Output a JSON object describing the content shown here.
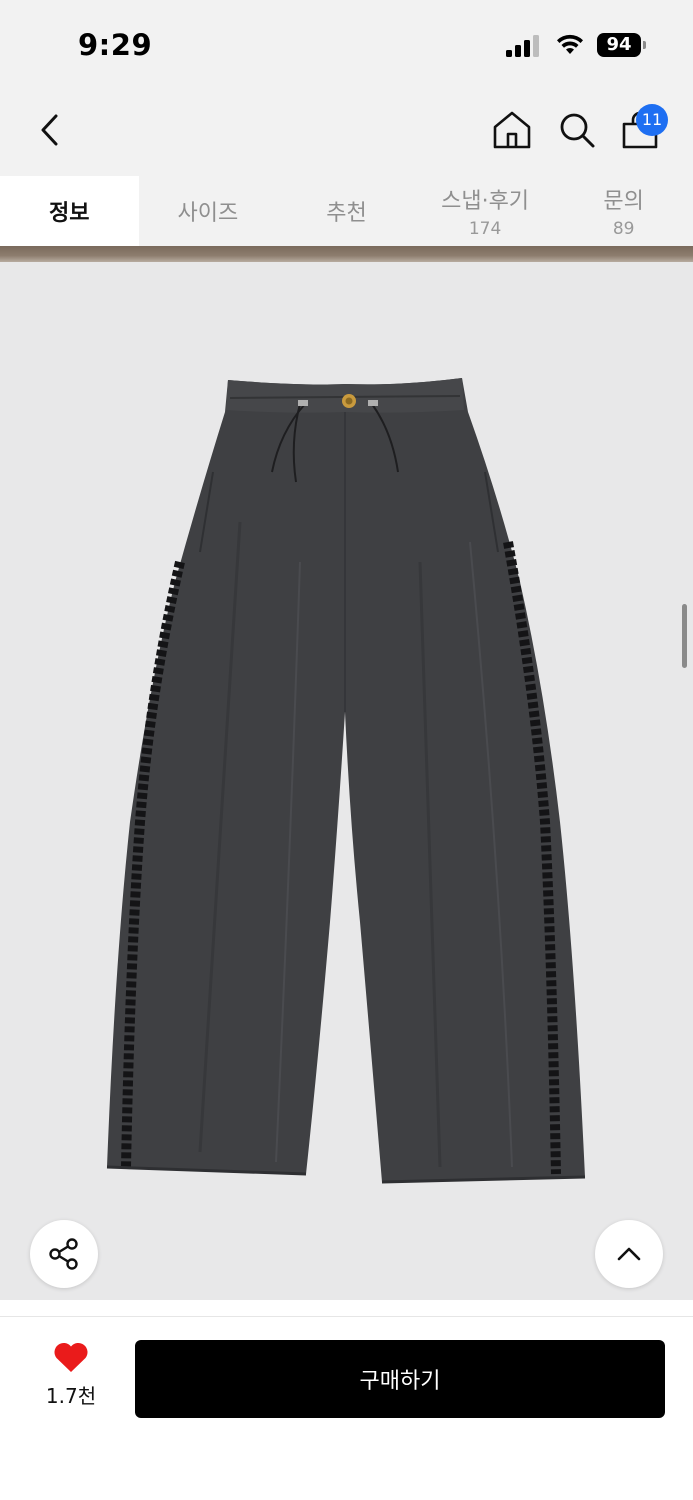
{
  "status_bar": {
    "time": "9:29",
    "battery_level": "94",
    "icons": [
      "cellular-signal-icon",
      "wifi-icon",
      "battery-icon"
    ]
  },
  "nav": {
    "icons": [
      "back-chevron-icon",
      "home-icon",
      "search-icon",
      "shopping-bag-icon"
    ],
    "cart_badge": "11",
    "badge_color": "#1e6ff2"
  },
  "tabs": [
    {
      "label": "정보",
      "count": "",
      "active": true
    },
    {
      "label": "사이즈",
      "count": "",
      "active": false
    },
    {
      "label": "추천",
      "count": "",
      "active": false
    },
    {
      "label": "스냅·후기",
      "count": "174",
      "active": false
    },
    {
      "label": "문의",
      "count": "89",
      "active": false
    }
  ],
  "product_image": {
    "subject": "dark gray wide-leg drawstring trousers with black lace side trim",
    "background_color": "#e8e8e9"
  },
  "floating_buttons": {
    "share_icon": "share-icon",
    "scroll_top_icon": "chevron-up-icon"
  },
  "bottom_bar": {
    "like_icon": "heart-icon",
    "like_color": "#ea1b1b",
    "like_count": "1.7천",
    "buy_label": "구매하기",
    "buy_color": "#000000"
  }
}
